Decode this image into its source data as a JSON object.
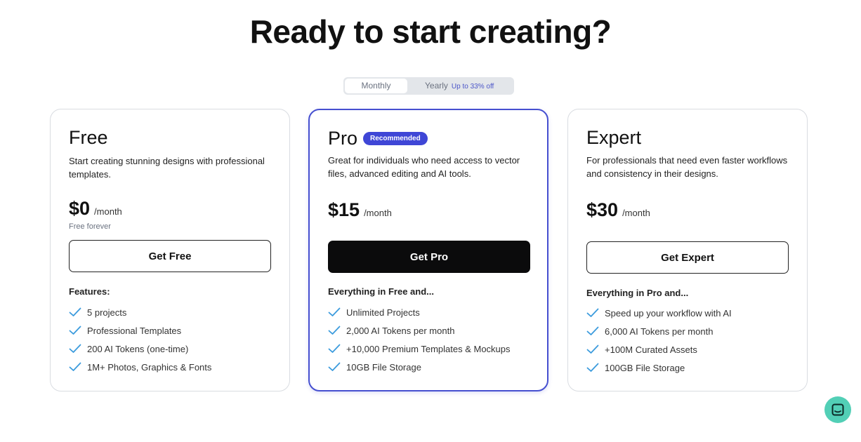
{
  "title": "Ready to start creating?",
  "billing_toggle": {
    "monthly_label": "Monthly",
    "yearly_label": "Yearly",
    "yearly_discount": "Up to 33% off",
    "selected": "Monthly"
  },
  "plans": [
    {
      "name": "Free",
      "description": "Start creating stunning designs with professional templates.",
      "price": "$0",
      "period": "/month",
      "note": "Free forever",
      "cta": "Get Free",
      "features_title": "Features:",
      "features": [
        "5 projects",
        "Professional Templates",
        "200 AI Tokens (one-time)",
        "1M+ Photos, Graphics & Fonts"
      ]
    },
    {
      "name": "Pro",
      "badge": "Recommended",
      "description": "Great for individuals who need access to vector files, advanced editing and AI tools.",
      "price": "$15",
      "period": "/month",
      "cta": "Get Pro",
      "features_title": "Everything in Free and...",
      "features": [
        "Unlimited Projects",
        "2,000 AI Tokens per month",
        "+10,000 Premium Templates & Mockups",
        "10GB File Storage"
      ]
    },
    {
      "name": "Expert",
      "description": "For professionals that need even faster workflows and consistency in their designs.",
      "price": "$30",
      "period": "/month",
      "cta": "Get Expert",
      "features_title": "Everything in Pro and...",
      "features": [
        "Speed up your workflow with AI",
        "6,000 AI Tokens per month",
        "+100M Curated Assets",
        "100GB File Storage"
      ]
    }
  ],
  "icons": {
    "feature": "check-icon",
    "chat": "chat-icon"
  },
  "colors": {
    "accent": "#3f46d6",
    "check": "#3b9bdd",
    "chat": "#52cfb6"
  }
}
